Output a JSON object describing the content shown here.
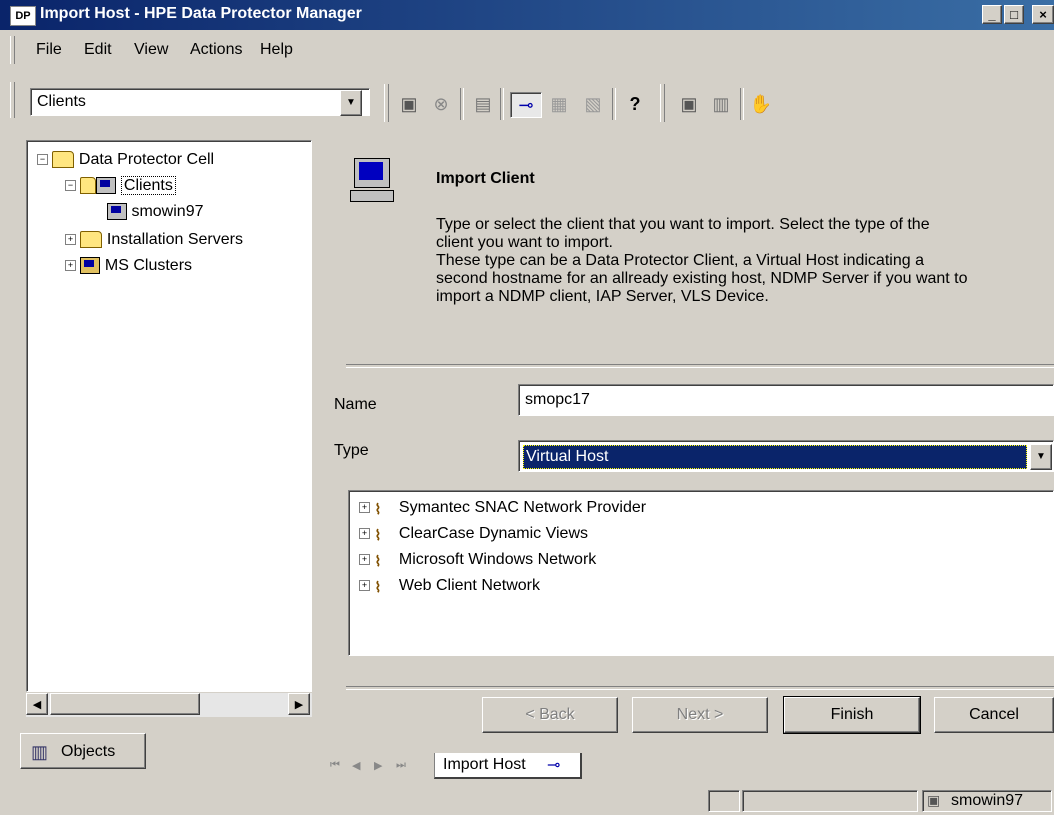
{
  "window": {
    "title": "Import Host - HPE Data Protector Manager",
    "app_icon_text": "DP",
    "minimize": "_",
    "maximize": "□",
    "close": "×"
  },
  "menu": [
    "File",
    "Edit",
    "View",
    "Actions",
    "Help"
  ],
  "toolbar": {
    "context_value": "Clients",
    "icons": [
      "clients-icon",
      "stop-icon",
      "window-icon",
      "pin-icon",
      "list-icon",
      "properties-icon",
      "help-icon",
      "new-client-icon",
      "new-cluster-icon",
      "hand-icon"
    ],
    "glyphs": {
      "help": "?",
      "hand": "✋"
    }
  },
  "tree": {
    "root": "Data Protector Cell",
    "items": [
      {
        "label": "Clients",
        "expanded": true
      },
      {
        "label": "smowin97"
      },
      {
        "label": "Installation Servers"
      },
      {
        "label": "MS Clusters"
      }
    ]
  },
  "left_tab": "Objects",
  "wizard": {
    "title": "Import Client",
    "description": [
      "Type or select the client that you want to import. Select the type of the",
      "client you want to import.",
      "These type can be a Data Protector Client, a Virtual Host indicating a",
      "second hostname for an allready existing host, NDMP Server if you want to",
      "import a NDMP client, IAP Server, VLS Device."
    ],
    "name_label": "Name",
    "name_value": "smopc17",
    "type_label": "Type",
    "type_value": "Virtual Host",
    "networks": [
      "Symantec SNAC Network Provider",
      "ClearCase Dynamic Views",
      "Microsoft Windows Network",
      "Web Client Network"
    ],
    "buttons": {
      "back": "< Back",
      "next": "Next >",
      "finish": "Finish",
      "cancel": "Cancel"
    }
  },
  "bottom_tab": "Import Host",
  "status": {
    "host": "smowin97"
  },
  "colors": {
    "titlebar": "#0a246a",
    "selection": "#0a246a",
    "face": "#d4d0c8"
  }
}
